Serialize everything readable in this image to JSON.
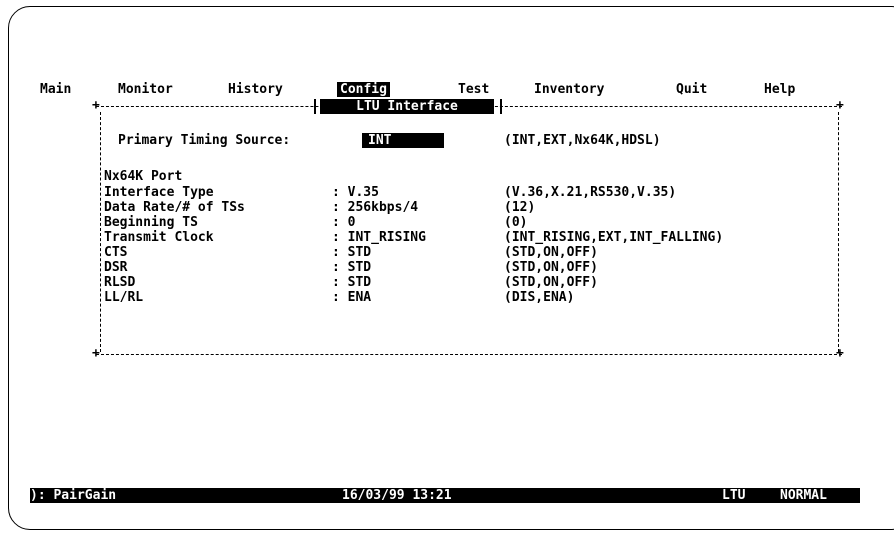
{
  "menu": {
    "items": [
      "Main",
      "Monitor",
      "History",
      "Config",
      "Test",
      "Inventory",
      "Quit",
      "Help"
    ],
    "active": "Config"
  },
  "panel": {
    "title": "LTU Interface",
    "primary_timing": {
      "label": "Primary Timing Source:",
      "value": "INT",
      "options": "(INT,EXT,Nx64K,HDSL)"
    },
    "section_title": "Nx64K Port",
    "rows": [
      {
        "label": "Interface Type",
        "value": ": V.35",
        "options": "(V.36,X.21,RS530,V.35)"
      },
      {
        "label": "Data Rate/# of TSs",
        "value": ": 256kbps/4",
        "options": "(12)"
      },
      {
        "label": "Beginning TS",
        "value": ": 0",
        "options": "(0)"
      },
      {
        "label": "Transmit Clock",
        "value": ": INT_RISING",
        "options": "(INT_RISING,EXT,INT_FALLING)"
      },
      {
        "label": "CTS",
        "value": ": STD",
        "options": "(STD,ON,OFF)"
      },
      {
        "label": "DSR",
        "value": ": STD",
        "options": "(STD,ON,OFF)"
      },
      {
        "label": "RLSD",
        "value": ": STD",
        "options": "(STD,ON,OFF)"
      },
      {
        "label": "LL/RL",
        "value": ": ENA",
        "options": "(DIS,ENA)"
      }
    ]
  },
  "status_bar": {
    "left": "): PairGain",
    "datetime": "16/03/99 13:21",
    "unit": "LTU",
    "state": "NORMAL"
  },
  "colors": {
    "background": "#ffffff",
    "foreground": "#000000",
    "highlight": "#000000"
  }
}
